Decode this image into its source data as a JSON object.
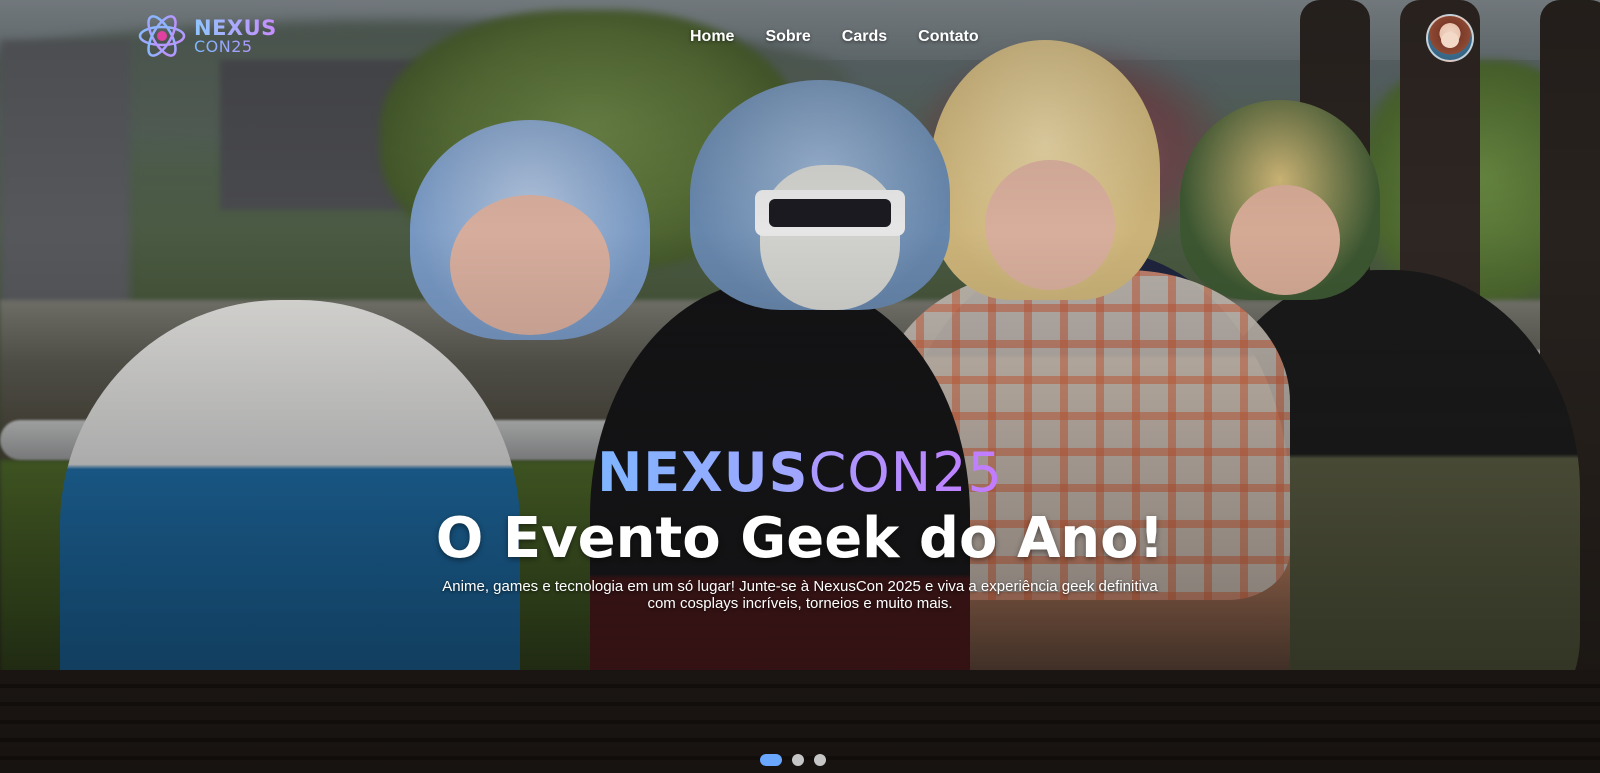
{
  "brand": {
    "logo_line1": "NEXUS",
    "logo_line2": "CON25",
    "logo_icon": "atom-icon"
  },
  "nav": {
    "items": [
      {
        "label": "Home"
      },
      {
        "label": "Sobre"
      },
      {
        "label": "Cards"
      },
      {
        "label": "Contato"
      }
    ],
    "avatar_icon": "user-avatar"
  },
  "hero": {
    "title_part1": "NEXUS",
    "title_part2": "CON25",
    "tagline": "O Evento Geek do Ano!",
    "description_line1": "Anime, games e tecnologia em um só lugar! Junte-se à NexusCon 2025 e viva a experiência geek definitiva",
    "description_line2": "com cosplays incríveis, torneios e muito mais."
  },
  "carousel": {
    "slides": 3,
    "active_index": 0
  },
  "colors": {
    "accent_blue": "#7fb5ff",
    "accent_purple": "#c37bff",
    "dot_active": "#6aa7ff"
  }
}
